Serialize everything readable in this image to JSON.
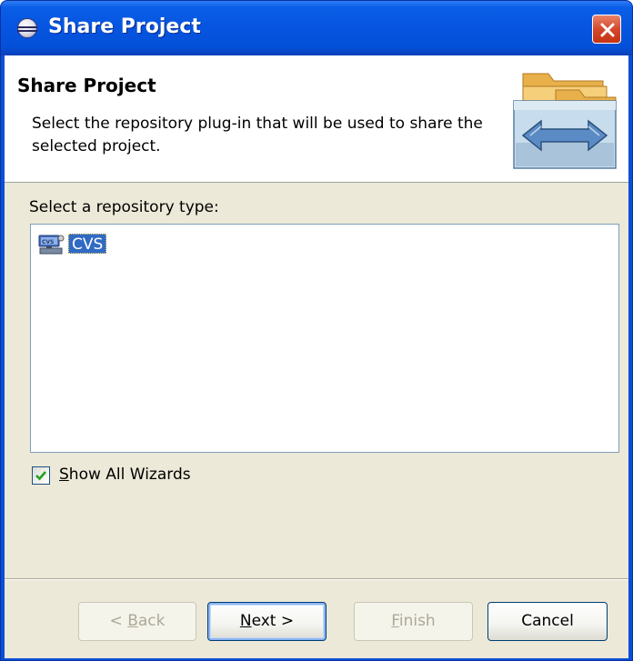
{
  "window": {
    "title": "Share Project"
  },
  "banner": {
    "title": "Share Project",
    "description": "Select the repository plug-in that will be used to share the selected project."
  },
  "repository": {
    "section_label": "Select a repository type:",
    "items": [
      {
        "label": "CVS",
        "icon": "cvs-repository-icon",
        "selected": true
      }
    ]
  },
  "show_all_wizards": {
    "label_mnemonic": "S",
    "label_rest": "how All Wizards",
    "checked": true
  },
  "buttons": {
    "back": {
      "prefix": "< ",
      "mnemonic": "B",
      "rest": "ack",
      "enabled": false
    },
    "next": {
      "mnemonic": "N",
      "rest": "ext >",
      "enabled": true
    },
    "finish": {
      "mnemonic": "F",
      "rest": "inish",
      "enabled": false
    },
    "cancel": {
      "label": "Cancel",
      "enabled": true
    }
  },
  "colors": {
    "titlebar": "#0654e0",
    "dialog_face": "#ece9d8",
    "selection": "#316ac5",
    "close_button": "#d6482a"
  }
}
